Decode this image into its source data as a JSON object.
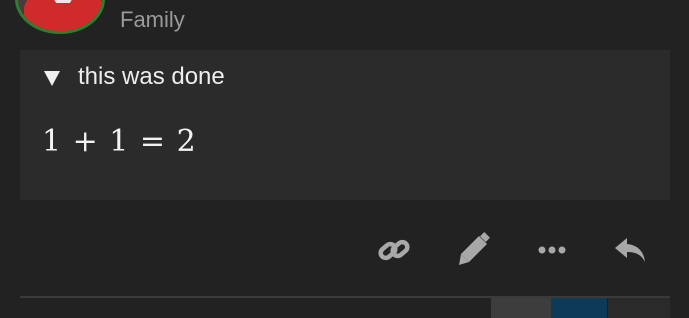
{
  "post": {
    "username": "",
    "category": "Family",
    "details": {
      "summary": "this was done",
      "math": "1 + 1 = 2"
    }
  },
  "actions": [
    {
      "icon": "link-icon"
    },
    {
      "icon": "pencil-icon"
    },
    {
      "icon": "ellipsis-icon"
    },
    {
      "icon": "reply-icon"
    }
  ],
  "colors": {
    "background": "#222222",
    "panel": "#2b2b2b",
    "avatar_border": "#2e7d32",
    "icon": "#a8a8a8",
    "accent_bottom": "#0d3a57"
  }
}
